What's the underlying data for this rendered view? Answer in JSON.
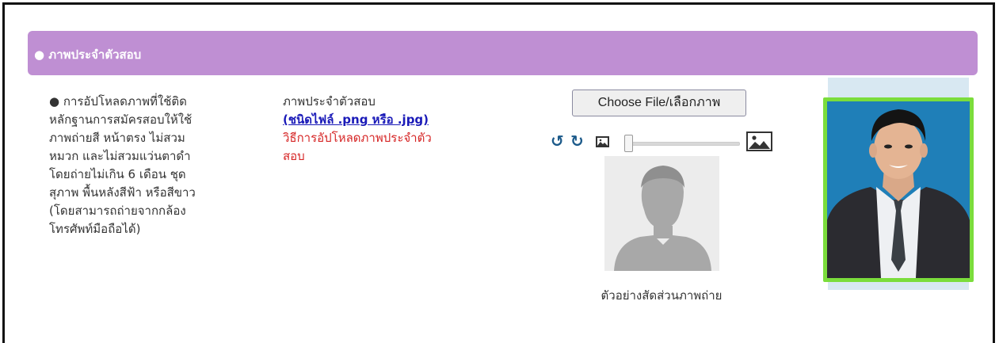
{
  "panel": {
    "title": "● ภาพประจำตัวสอบ"
  },
  "instructions": {
    "lines": [
      "● การอัปโหลดภาพที่ใช้ติด",
      "หลักฐานการสมัครสอบให้ใช้",
      "ภาพถ่ายสี หน้าตรง ไม่สวม",
      "หมวก และไม่สวมแว่นตาดำ",
      "โดยถ่ายไม่เกิน 6 เดือน ชุด",
      "สุภาพ พื้นหลังสีฟ้า หรือสีขาว",
      "(โดยสามารถถ่ายจากกล้อง",
      "โทรศัพท์มือถือได้)"
    ]
  },
  "upload": {
    "label": "ภาพประจำตัวสอบ",
    "file_type_link": "(ชนิดไฟล์ .png หรือ .jpg)",
    "how_to_link_line1": "วิธีการอัปโหลดภาพประจำตัว",
    "how_to_link_line2": "สอบ",
    "choose_button": "Choose File/เลือกภาพ",
    "rotate_left_glyph": "↺",
    "rotate_right_glyph": "↻",
    "zoom_level": 0,
    "sample_caption": "ตัวอย่างสัดส่วนภาพถ่าย"
  },
  "colors": {
    "header_bg": "#bf8fd3",
    "link_blue": "#1a1ab8",
    "link_red": "#d62525",
    "photo_border": "#7bdd3c"
  }
}
